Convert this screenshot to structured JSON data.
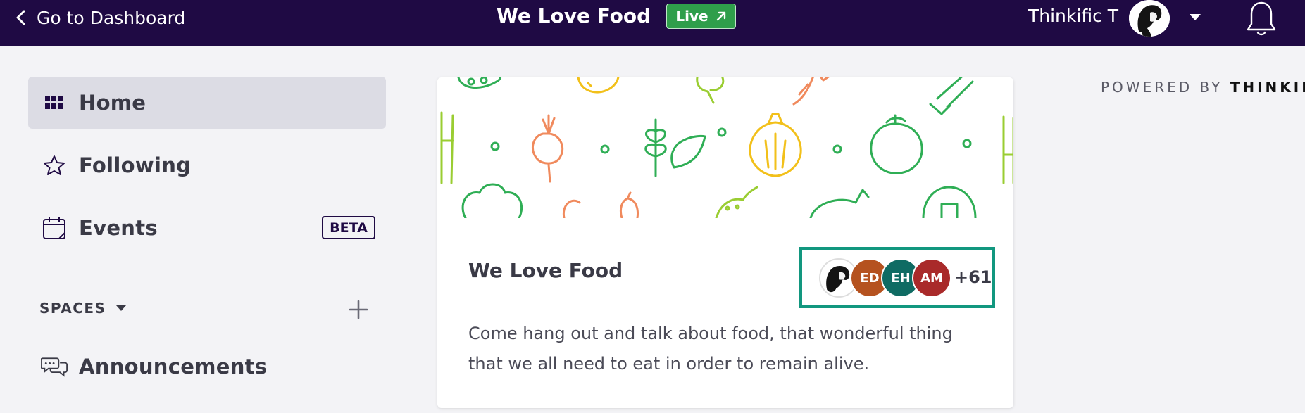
{
  "topbar": {
    "back_label": "Go to Dashboard",
    "community_title": "We Love Food",
    "live_label": "Live",
    "user_name": "Thinkific T",
    "colors": {
      "background": "#1f0a44",
      "live": "#2f9e4b"
    }
  },
  "sidebar": {
    "items": [
      {
        "label": "Home",
        "icon": "grid-icon",
        "active": true
      },
      {
        "label": "Following",
        "icon": "star-icon",
        "active": false
      },
      {
        "label": "Events",
        "icon": "calendar-icon",
        "active": false,
        "badge": "BETA"
      }
    ],
    "spaces_label": "SPACES",
    "spaces": [
      {
        "label": "Announcements",
        "icon": "chat-bubbles-icon"
      }
    ]
  },
  "card": {
    "title": "We Love Food",
    "description": "Come hang out and talk about food, that wonderful thing that we all need to eat in order to remain alive.",
    "members": [
      {
        "initials": "",
        "kind": "photo"
      },
      {
        "initials": "ED",
        "color": "#b5521f"
      },
      {
        "initials": "EH",
        "color": "#0f6b63"
      },
      {
        "initials": "AM",
        "color": "#a92a2a"
      }
    ],
    "more_count": "+61",
    "highlight_color": "#12977f"
  },
  "powered_by": {
    "prefix": "POWERED BY",
    "brand": "THINKIF"
  }
}
